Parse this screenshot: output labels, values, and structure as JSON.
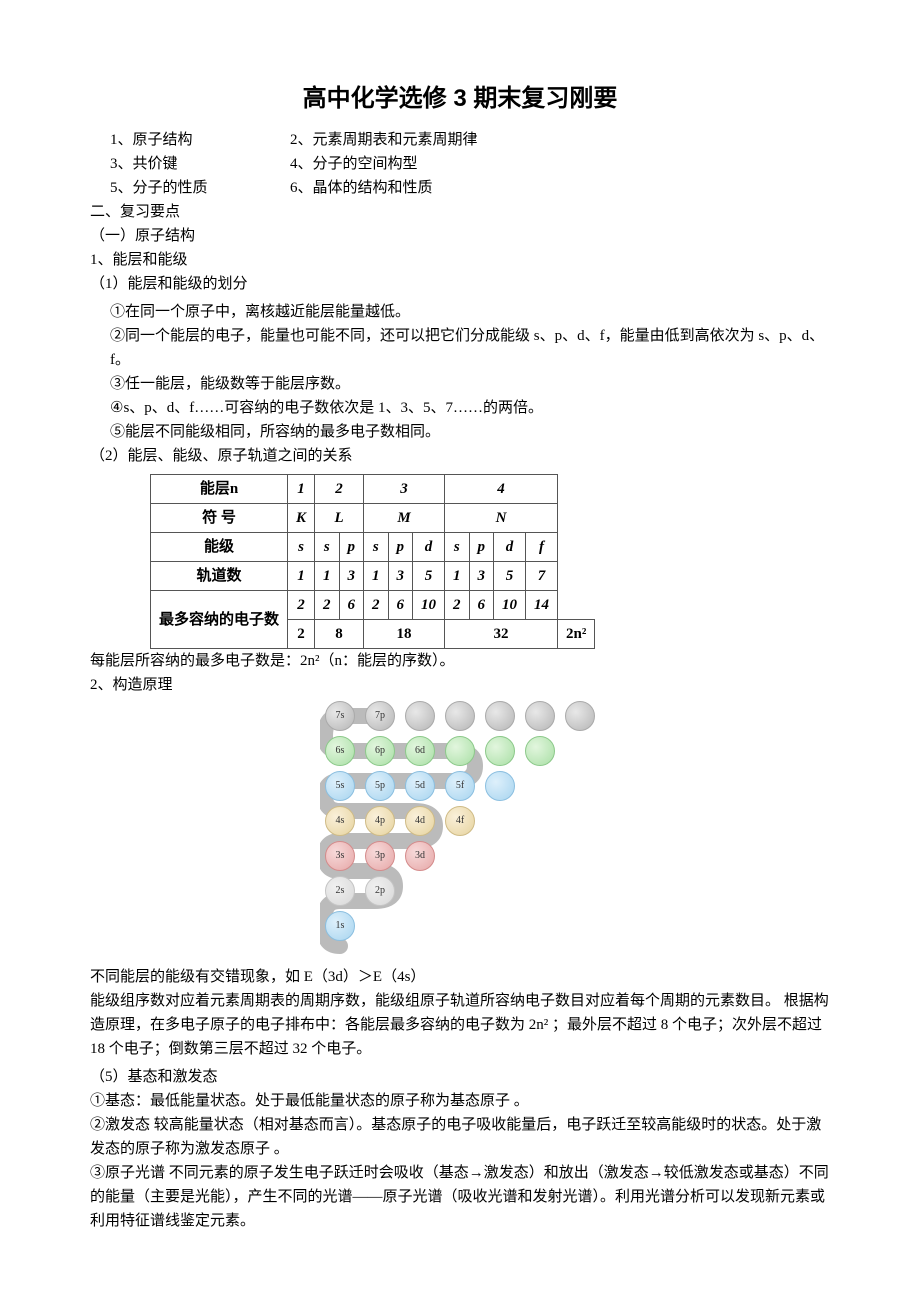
{
  "title": "高中化学选修 3 期末复习刚要",
  "topics": [
    [
      "1、原子结构",
      "2、元素周期表和元素周期律"
    ],
    [
      "3、共价键",
      "4、分子的空间构型"
    ],
    [
      "5、分子的性质",
      "6、晶体的结构和性质"
    ]
  ],
  "sec2": "二、复习要点",
  "sub1": "（一）原子结构",
  "sub1_1": "1、能层和能级",
  "sub1_1_1": "（1）能层和能级的划分",
  "bullets": [
    "①在同一个原子中，离核越近能层能量越低。",
    "②同一个能层的电子，能量也可能不同，还可以把它们分成能级 s、p、d、f，能量由低到高依次为 s、p、d、f。",
    "③任一能层，能级数等于能层序数。",
    "④s、p、d、f……可容纳的电子数依次是 1、3、5、7……的两倍。",
    "⑤能层不同能级相同，所容纳的最多电子数相同。"
  ],
  "sub1_1_2": "（2）能层、能级、原子轨道之间的关系",
  "table": {
    "rows": [
      {
        "hdr": "能层n",
        "cells": [
          "1",
          "2",
          "3",
          "4"
        ],
        "spans": [
          1,
          2,
          3,
          4
        ]
      },
      {
        "hdr": "符 号",
        "cells": [
          "K",
          "L",
          "M",
          "N"
        ],
        "spans": [
          1,
          2,
          3,
          4
        ]
      },
      {
        "hdr": "能级",
        "cells": [
          "s",
          "s",
          "p",
          "s",
          "p",
          "d",
          "s",
          "p",
          "d",
          "f"
        ]
      },
      {
        "hdr": "轨道数",
        "cells": [
          "1",
          "1",
          "3",
          "1",
          "3",
          "5",
          "1",
          "3",
          "5",
          "7"
        ]
      },
      {
        "hdr": "最多容纳的电子数",
        "cells": [
          "2",
          "2",
          "6",
          "2",
          "6",
          "10",
          "2",
          "6",
          "10",
          "14"
        ]
      },
      {
        "hdr": "",
        "cells": [
          "2",
          "8",
          "18",
          "32"
        ],
        "spans": [
          1,
          2,
          3,
          4
        ],
        "tail": "2n²"
      }
    ],
    "tail": "2n²"
  },
  "after_table": "每能层所容纳的最多电子数是：2n²（n：能层的序数）。",
  "sub1_2": "2、构造原理",
  "aufbau_orbitals": [
    {
      "r": 0,
      "c": 0,
      "cls": "c-gray",
      "t": "7s"
    },
    {
      "r": 0,
      "c": 1,
      "cls": "c-gray",
      "t": "7p"
    },
    {
      "r": 0,
      "c": 2,
      "cls": "c-gray",
      "t": ""
    },
    {
      "r": 0,
      "c": 3,
      "cls": "c-gray",
      "t": ""
    },
    {
      "r": 0,
      "c": 4,
      "cls": "c-gray",
      "t": ""
    },
    {
      "r": 0,
      "c": 5,
      "cls": "c-gray",
      "t": ""
    },
    {
      "r": 0,
      "c": 6,
      "cls": "c-gray",
      "t": ""
    },
    {
      "r": 1,
      "c": 0,
      "cls": "c-green",
      "t": "6s"
    },
    {
      "r": 1,
      "c": 1,
      "cls": "c-green",
      "t": "6p"
    },
    {
      "r": 1,
      "c": 2,
      "cls": "c-green",
      "t": "6d"
    },
    {
      "r": 1,
      "c": 3,
      "cls": "c-green",
      "t": ""
    },
    {
      "r": 1,
      "c": 4,
      "cls": "c-green",
      "t": ""
    },
    {
      "r": 1,
      "c": 5,
      "cls": "c-green",
      "t": ""
    },
    {
      "r": 2,
      "c": 0,
      "cls": "c-blue",
      "t": "5s"
    },
    {
      "r": 2,
      "c": 1,
      "cls": "c-blue",
      "t": "5p"
    },
    {
      "r": 2,
      "c": 2,
      "cls": "c-blue",
      "t": "5d"
    },
    {
      "r": 2,
      "c": 3,
      "cls": "c-blue",
      "t": "5f"
    },
    {
      "r": 2,
      "c": 4,
      "cls": "c-blue",
      "t": ""
    },
    {
      "r": 3,
      "c": 0,
      "cls": "c-tan",
      "t": "4s"
    },
    {
      "r": 3,
      "c": 1,
      "cls": "c-tan",
      "t": "4p"
    },
    {
      "r": 3,
      "c": 2,
      "cls": "c-tan",
      "t": "4d"
    },
    {
      "r": 3,
      "c": 3,
      "cls": "c-tan",
      "t": "4f"
    },
    {
      "r": 4,
      "c": 0,
      "cls": "c-red",
      "t": "3s"
    },
    {
      "r": 4,
      "c": 1,
      "cls": "c-red",
      "t": "3p"
    },
    {
      "r": 4,
      "c": 2,
      "cls": "c-red",
      "t": "3d"
    },
    {
      "r": 5,
      "c": 0,
      "cls": "c-ltg",
      "t": "2s"
    },
    {
      "r": 5,
      "c": 1,
      "cls": "c-ltg",
      "t": "2p"
    },
    {
      "r": 6,
      "c": 0,
      "cls": "c-blue",
      "t": "1s"
    }
  ],
  "after_aufbau_1": "不同能层的能级有交错现象，如 E（3d）＞E（4s）",
  "after_aufbau_2": "能级组序数对应着元素周期表的周期序数，能级组原子轨道所容纳电子数目对应着每个周期的元素数目。 根据构造原理，在多电子原子的电子排布中：各能层最多容纳的电子数为 2n² ；最外层不超过 8 个电子；次外层不超过 18 个电子；倒数第三层不超过 32 个电子。",
  "sub1_5": "（5）基态和激发态",
  "ground_excited": [
    "①基态：最低能量状态。处于最低能量状态的原子称为基态原子 。",
    "②激发态  较高能量状态（相对基态而言）。基态原子的电子吸收能量后，电子跃迁至较高能级时的状态。处于激发态的原子称为激发态原子 。",
    "③原子光谱  不同元素的原子发生电子跃迁时会吸收（基态→激发态）和放出（激发态→较低激发态或基态）不同的能量（主要是光能），产生不同的光谱——原子光谱（吸收光谱和发射光谱）。利用光谱分析可以发现新元素或利用特征谱线鉴定元素。"
  ]
}
